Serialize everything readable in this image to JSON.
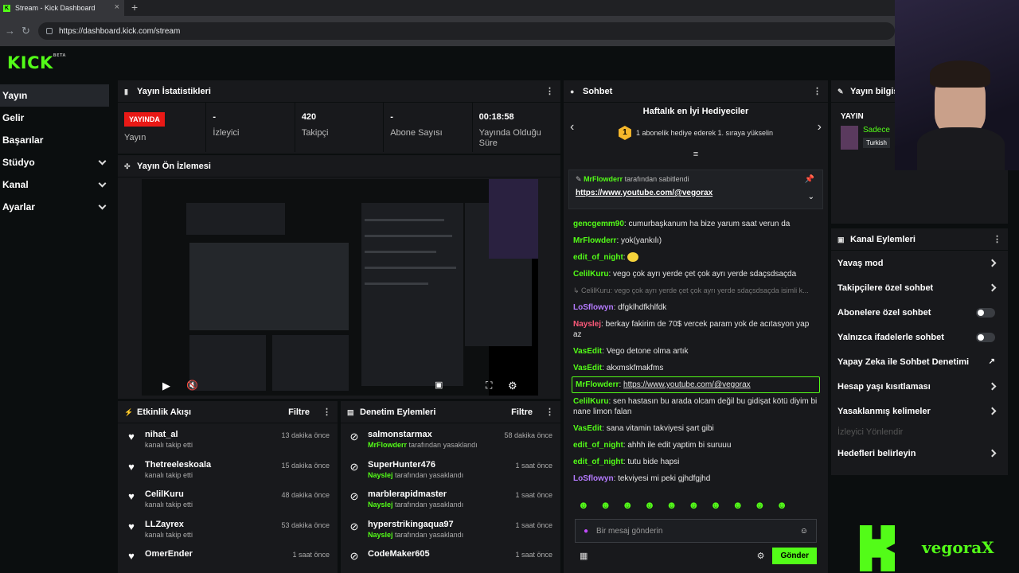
{
  "browser": {
    "tab_title": "Stream - Kick Dashboard",
    "url": "https://dashboard.kick.com/stream"
  },
  "brand": {
    "logo": "KICK",
    "logo_sup": "BETA",
    "accent": "#53fc18"
  },
  "sidebar": {
    "items": [
      {
        "label": "Yayın",
        "active": true
      },
      {
        "label": "Gelir"
      },
      {
        "label": "Başarılar"
      },
      {
        "label": "Stüdyo",
        "expand": true
      },
      {
        "label": "Kanal",
        "expand": true
      },
      {
        "label": "Ayarlar",
        "expand": true
      }
    ]
  },
  "stats_panel": {
    "title": "Yayın İstatistikleri",
    "live_badge": "YAYINDA",
    "stats": [
      {
        "value": "",
        "label": "Yayın"
      },
      {
        "value": "-",
        "label": "İzleyici"
      },
      {
        "value": "420",
        "label": "Takipçi"
      },
      {
        "value": "-",
        "label": "Abone Sayısı"
      },
      {
        "value": "00:18:58",
        "label": "Yayında Olduğu Süre"
      }
    ]
  },
  "preview_panel": {
    "title": "Yayın Ön İzlemesi"
  },
  "activity": {
    "title": "Etkinlik Akışı",
    "filter": "Filtre",
    "items": [
      {
        "name": "nihat_al",
        "action": "kanalı takip etti",
        "time": "13 dakika önce"
      },
      {
        "name": "Thetreeleskoala",
        "action": "kanalı takip etti",
        "time": "15 dakika önce"
      },
      {
        "name": "CelilKuru",
        "action": "kanalı takip etti",
        "time": "48 dakika önce"
      },
      {
        "name": "LLZayrex",
        "action": "kanalı takip etti",
        "time": "53 dakika önce"
      },
      {
        "name": "OmerEnder",
        "action": "",
        "time": "1 saat önce"
      }
    ]
  },
  "moderation": {
    "title": "Denetim Eylemleri",
    "filter": "Filtre",
    "items": [
      {
        "name": "salmonstarmax",
        "by": "MrFlowderr",
        "action": "tarafından yasaklandı",
        "time": "58 dakika önce"
      },
      {
        "name": "SuperHunter476",
        "by": "Nayslej",
        "action": "tarafından yasaklandı",
        "time": "1 saat önce"
      },
      {
        "name": "marblerapidmaster",
        "by": "Nayslej",
        "action": "tarafından yasaklandı",
        "time": "1 saat önce"
      },
      {
        "name": "hyperstrikingaqua97",
        "by": "Nayslej",
        "action": "tarafından yasaklandı",
        "time": "1 saat önce"
      },
      {
        "name": "CodeMaker605",
        "by": "",
        "action": "",
        "time": "1 saat önce"
      }
    ]
  },
  "chat": {
    "title": "Sohbet",
    "gifters_title": "Haftalık en İyi Hediyeciler",
    "gifters_rank": "1",
    "gifters_text": "1 abonelik hediye ederek 1. sıraya yükselin",
    "pinned_by": "MrFlowderr",
    "pinned_suffix": "tarafından sabitlendi",
    "pinned_link": "https://www.youtube.com/@vegorax",
    "messages": [
      {
        "user": "gencgemm90",
        "color": "#53fc18",
        "text": "cumurbaşkanum ha bize yarum saat verun da"
      },
      {
        "user": "MrFlowderr",
        "color": "#53fc18",
        "text": "yok(yankılı)"
      },
      {
        "user": "edit_of_night",
        "color": "#53fc18",
        "text": ""
      },
      {
        "user": "CelilKuru",
        "color": "#53fc18",
        "text": "vego çok ayrı yerde çet çok ayrı yerde sdaçsdsaçda"
      },
      {
        "user": "CelilKuru",
        "color": "#888",
        "text": "vego çok ayrı yerde çet çok ayrı yerde sdaçsdsaçda isimli k..."
      },
      {
        "user": "LoSflowyn",
        "color": "#b57bff",
        "text": "dfgklhdfkhlfdk"
      },
      {
        "user": "Nayslej",
        "color": "#ff5a7a",
        "text": "berkay fakirim de 70$ vercek param yok de acıtasyon yap az"
      },
      {
        "user": "VasEdit",
        "color": "#53fc18",
        "text": "Vego detone olma artık"
      },
      {
        "user": "VasEdit",
        "color": "#53fc18",
        "text": "akxmskfmakfms"
      },
      {
        "user": "MrFlowderr",
        "color": "#53fc18",
        "text": "https://www.youtube.com/@vegorax"
      },
      {
        "user": "CelilKuru",
        "color": "#53fc18",
        "text": "sen hastasın bu arada olcam değil bu gidişat kötü diyim bi nane limon falan"
      },
      {
        "user": "VasEdit",
        "color": "#53fc18",
        "text": "sana vitamin takviyesi şart gibi"
      },
      {
        "user": "edit_of_night",
        "color": "#53fc18",
        "text": "ahhh ile edit yaptim bi suruuu"
      },
      {
        "user": "edit_of_night",
        "color": "#53fc18",
        "text": "tutu bide hapsi"
      },
      {
        "user": "LoSflowyn",
        "color": "#b57bff",
        "text": "tekviyesi mi peki gjhdfgjhd"
      }
    ],
    "input_placeholder": "Bir mesaj gönderin",
    "send": "Gönder"
  },
  "stream_info": {
    "title": "Yayın bilgisi",
    "section": "YAYIN",
    "streamer_line": "Sadece",
    "language": "Turkish"
  },
  "channel_actions": {
    "title": "Kanal Eylemleri",
    "items": [
      {
        "label": "Yavaş mod",
        "kind": "arrow"
      },
      {
        "label": "Takipçilere özel sohbet",
        "kind": "arrow"
      },
      {
        "label": "Abonelere özel sohbet",
        "kind": "toggle"
      },
      {
        "label": "Yalnızca ifadelerle sohbet",
        "kind": "toggle"
      },
      {
        "label": "Yapay Zeka ile Sohbet Denetimi",
        "kind": "chart"
      },
      {
        "label": "Hesap yaşı kısıtlaması",
        "kind": "arrow"
      },
      {
        "label": "Yasaklanmış kelimeler",
        "kind": "arrow"
      },
      {
        "label": "İzleyici Yönlendir",
        "kind": "disabled"
      },
      {
        "label": "Hedefleri belirleyin",
        "kind": "arrow"
      }
    ]
  },
  "overlay": {
    "watermark": "vegoraX"
  }
}
